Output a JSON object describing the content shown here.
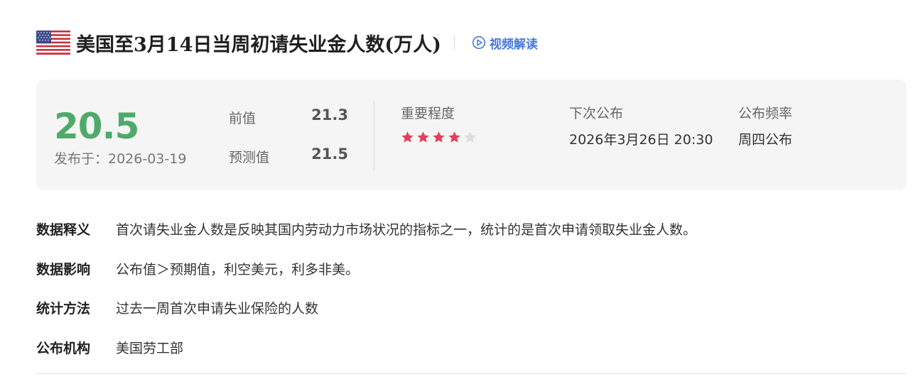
{
  "header": {
    "flag_icon": "us-flag-icon",
    "title": "美国至3月14日当周初请失业金人数(万人)",
    "video_link_label": "视频解读"
  },
  "summary": {
    "actual_value": "20.5",
    "publish_date": "发布于：2026-03-19",
    "previous": {
      "label": "前值",
      "value": "21.3"
    },
    "forecast": {
      "label": "预测值",
      "value": "21.5"
    },
    "importance": {
      "label": "重要程度",
      "stars_filled": 4,
      "stars_total": 5
    },
    "next_release": {
      "label": "下次公布",
      "value": "2026年3月26日 20:30"
    },
    "frequency": {
      "label": "公布频率",
      "value": "周四公布"
    }
  },
  "details": [
    {
      "key": "数据释义",
      "value": "首次请失业金人数是反映其国内劳动力市场状况的指标之一，统计的是首次申请领取失业金人数。"
    },
    {
      "key": "数据影响",
      "value": "公布值＞预期值，利空美元，利多非美。"
    },
    {
      "key": "统计方法",
      "value": "过去一周首次申请失业保险的人数"
    },
    {
      "key": "公布机构",
      "value": "美国劳工部"
    }
  ],
  "colors": {
    "actual_green": "#4faa6a",
    "star_red": "#e0405a",
    "star_empty": "#dddddd",
    "link_blue": "#4a78d8"
  }
}
